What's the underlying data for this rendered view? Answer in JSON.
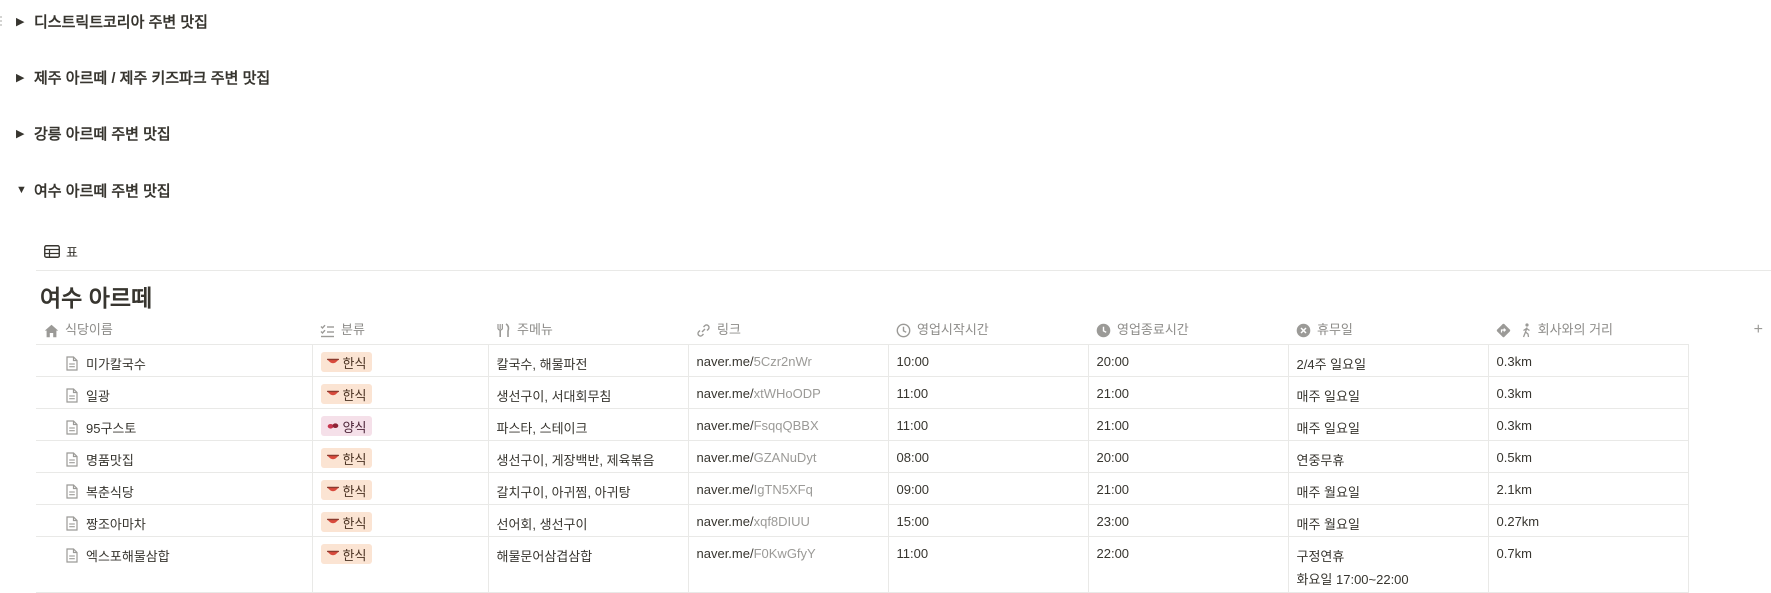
{
  "toggles": [
    {
      "label": "디스트릭트코리아 주변 맛집",
      "expanded": false
    },
    {
      "label": "제주 아르떼 / 제주 키즈파크 주변 맛집",
      "expanded": false
    },
    {
      "label": "강릉 아르떼 주변 맛집",
      "expanded": false
    },
    {
      "label": "여수 아르떼 주변 맛집",
      "expanded": true
    }
  ],
  "view": {
    "tab_icon": "table-icon",
    "tab_label": "표"
  },
  "database": {
    "title": "여수 아르떼",
    "columns": [
      {
        "key": "name",
        "label": "식당이름",
        "icon": "home-icon"
      },
      {
        "key": "category",
        "label": "분류",
        "icon": "checklist-icon"
      },
      {
        "key": "menu",
        "label": "주메뉴",
        "icon": "utensils-icon"
      },
      {
        "key": "link",
        "label": "링크",
        "icon": "link-icon"
      },
      {
        "key": "open",
        "label": "영업시작시간",
        "icon": "clock-outline-icon"
      },
      {
        "key": "close",
        "label": "영업종료시간",
        "icon": "clock-filled-icon"
      },
      {
        "key": "holiday",
        "label": "휴무일",
        "icon": "x-circle-icon"
      },
      {
        "key": "distance",
        "label": "회사와의 거리",
        "icon": "directions-walk-icon"
      }
    ],
    "rows": [
      {
        "name": "미가칼국수",
        "category": "한식",
        "menu": "칼국수, 해물파전",
        "link_host": "naver.me/",
        "link_path": "5Czr2nWr",
        "open": "10:00",
        "close": "20:00",
        "holiday": "2/4주 일요일",
        "holiday_sub": "",
        "distance": "0.3km"
      },
      {
        "name": "일광",
        "category": "한식",
        "menu": "생선구이, 서대회무침",
        "link_host": "naver.me/",
        "link_path": "xtWHoODP",
        "open": "11:00",
        "close": "21:00",
        "holiday": "매주 일요일",
        "holiday_sub": "",
        "distance": "0.3km"
      },
      {
        "name": "95구스토",
        "category": "양식",
        "menu": "파스타, 스테이크",
        "link_host": "naver.me/",
        "link_path": "FsqqQBBX",
        "open": "11:00",
        "close": "21:00",
        "holiday": "매주 일요일",
        "holiday_sub": "",
        "distance": "0.3km"
      },
      {
        "name": "명품맛집",
        "category": "한식",
        "menu": "생선구이, 게장백반, 제육볶음",
        "link_host": "naver.me/",
        "link_path": "GZANuDyt",
        "open": "08:00",
        "close": "20:00",
        "holiday": "연중무휴",
        "holiday_sub": "",
        "distance": "0.5km"
      },
      {
        "name": "복춘식당",
        "category": "한식",
        "menu": "갈치구이, 아귀찜, 아귀탕",
        "link_host": "naver.me/",
        "link_path": "IgTN5XFq",
        "open": "09:00",
        "close": "21:00",
        "holiday": "매주 월요일",
        "holiday_sub": "",
        "distance": "2.1km"
      },
      {
        "name": "짱조아마차",
        "category": "한식",
        "menu": "선어회, 생선구이",
        "link_host": "naver.me/",
        "link_path": "xqf8DIUU",
        "open": "15:00",
        "close": "23:00",
        "holiday": "매주 월요일",
        "holiday_sub": "",
        "distance": "0.27km"
      },
      {
        "name": "엑스포해물삼합",
        "category": "한식",
        "menu": "해물문어삼겹삼합",
        "link_host": "naver.me/",
        "link_path": "F0KwGfyY",
        "open": "11:00",
        "close": "22:00",
        "holiday": "구정연휴",
        "holiday_sub": "화요일 17:00~22:00",
        "distance": "0.7km"
      }
    ],
    "add_column_label": "+"
  },
  "colors": {
    "korean_tag_bg": "#fbe4d3",
    "western_tag_bg": "#f5e0e9",
    "text": "#37352f",
    "muted": "#9b9a97"
  }
}
